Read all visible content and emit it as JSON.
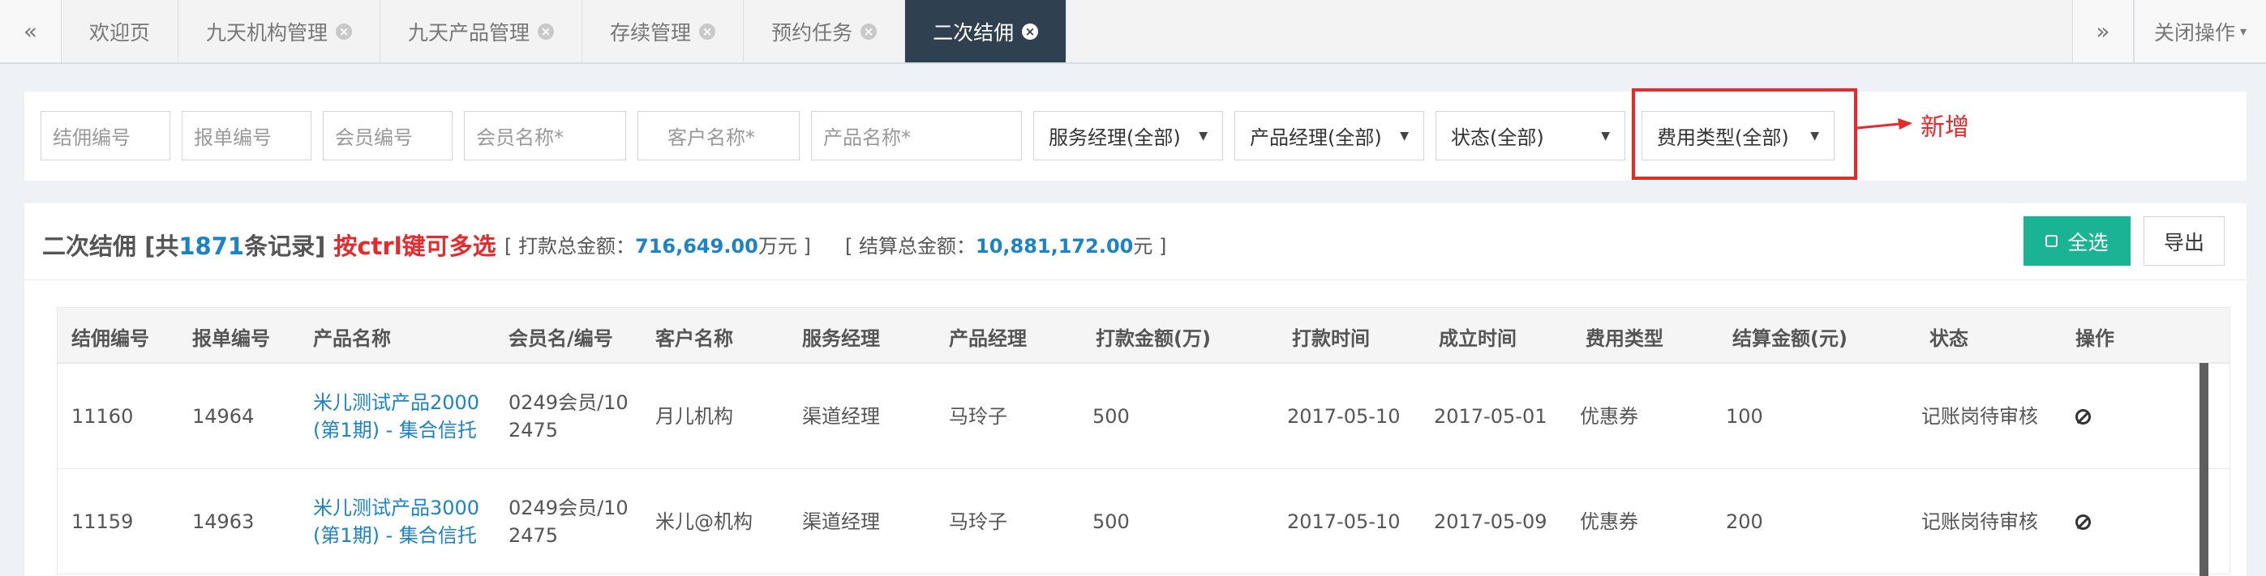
{
  "tabs": {
    "prev": "«",
    "next": "»",
    "items": [
      {
        "label": "欢迎页",
        "closable": false
      },
      {
        "label": "九天机构管理",
        "closable": true
      },
      {
        "label": "九天产品管理",
        "closable": true
      },
      {
        "label": "存续管理",
        "closable": true
      },
      {
        "label": "预约任务",
        "closable": true
      },
      {
        "label": "二次结佣",
        "closable": true,
        "active": true
      }
    ],
    "close_ops": "关闭操作"
  },
  "filters": {
    "inputs": {
      "commission_no": "结佣编号",
      "report_no": "报单编号",
      "member_no": "会员编号",
      "member_name": "会员名称*",
      "customer_name": "客户名称*",
      "product_name": "产品名称*"
    },
    "selects": {
      "service_manager": "服务经理(全部)",
      "product_manager": "产品经理(全部)",
      "status": "状态(全部)",
      "fee_type": "费用类型(全部)"
    },
    "annotation": "新增"
  },
  "summary": {
    "title_prefix": "二次结佣 [共",
    "count": "1871",
    "title_suffix": "条记录]",
    "hint": "按ctrl键可多选",
    "pay_label": "[ 打款总金额：",
    "pay_value": "716,649.00",
    "pay_unit": "万元 ]",
    "settle_label": "[ 结算总金额：",
    "settle_value": "10,881,172.00",
    "settle_unit": "元 ]"
  },
  "buttons": {
    "select_all": "全选",
    "export": "导出"
  },
  "table": {
    "columns": [
      "结佣编号",
      "报单编号",
      "产品名称",
      "会员名/编号",
      "客户名称",
      "服务经理",
      "产品经理",
      "打款金额(万)",
      "打款时间",
      "成立时间",
      "费用类型",
      "结算金额(元)",
      "状态",
      "操作"
    ],
    "rows": [
      {
        "commission_no": "11160",
        "report_no": "14964",
        "product_line1": "米儿测试产品2000",
        "product_line2": "(第1期) - 集合信托",
        "member_line1": "0249会员/10",
        "member_line2": "2475",
        "customer": "月儿机构",
        "service_manager": "渠道经理",
        "product_manager": "马玲子",
        "pay_amount": "500",
        "pay_date": "2017-05-10",
        "setup_date": "2017-05-01",
        "fee_type": "优惠券",
        "settle_amount": "100",
        "status": "记账岗待审核",
        "action_icon": "ban-icon"
      },
      {
        "commission_no": "11159",
        "report_no": "14963",
        "product_line1": "米儿测试产品3000",
        "product_line2": "(第1期) - 集合信托",
        "member_line1": "0249会员/10",
        "member_line2": "2475",
        "customer": "米儿@机构",
        "service_manager": "渠道经理",
        "product_manager": "马玲子",
        "pay_amount": "500",
        "pay_date": "2017-05-10",
        "setup_date": "2017-05-09",
        "fee_type": "优惠券",
        "settle_amount": "200",
        "status": "记账岗待审核",
        "action_icon": "ban-icon"
      }
    ]
  },
  "colors": {
    "tab_active_bg": "#2f4050",
    "accent_blue": "#1c84c6",
    "highlight_red": "#e8292c",
    "select_all_green": "#1ab394"
  }
}
